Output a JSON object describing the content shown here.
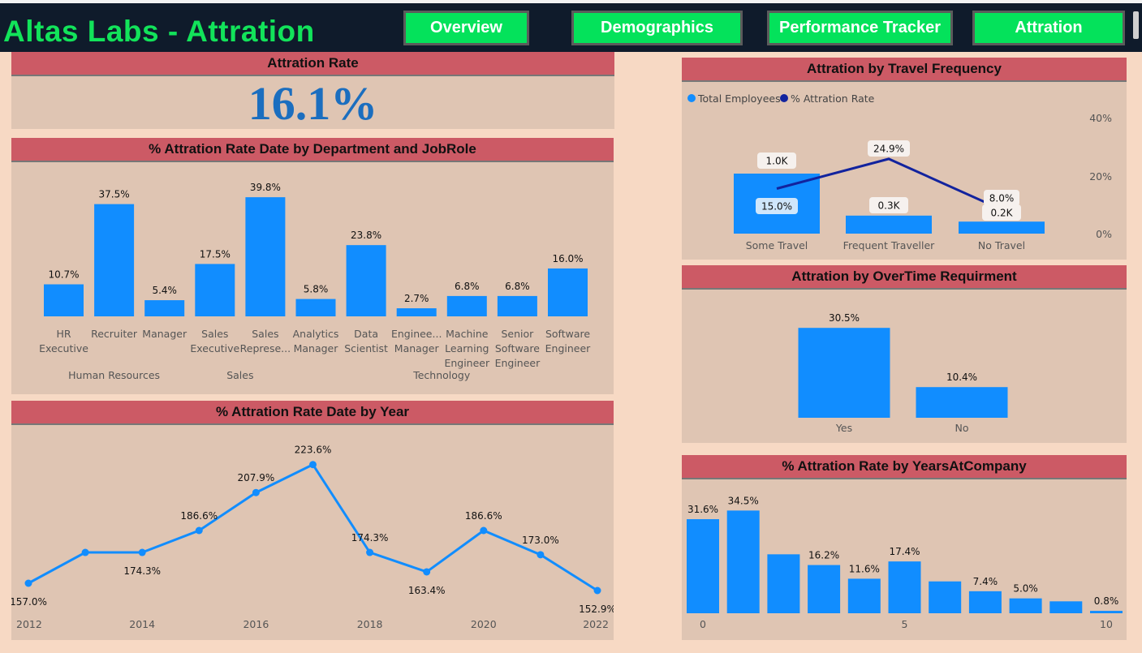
{
  "header": {
    "title": "Altas Labs - Attration",
    "nav": [
      "Overview",
      "Demographics",
      "Performance Tracker",
      "Attration"
    ]
  },
  "colors": {
    "accent": "#118dff",
    "line_dark": "#12239e",
    "header_bar": "#cc5a65",
    "nav_green": "#04e25b",
    "panel_bg": "#dfc5b3",
    "page_bg": "#f7d9c4",
    "kpi_blue": "#1b6ebf"
  },
  "kpi": {
    "title": "Attration Rate",
    "value": "16.1%"
  },
  "panels": {
    "dept_title": "% Attration Rate Date by Department and JobRole",
    "year_title": "% Attration Rate Date by Year",
    "travel_title": "Attration by Travel Frequency",
    "overtime_title": "Attration by OverTime Requirment",
    "years_title": "% Attration Rate by YearsAtCompany"
  },
  "chart_data": [
    {
      "id": "dept",
      "type": "bar",
      "categories": [
        [
          "HR",
          "Executive"
        ],
        [
          "Recruiter"
        ],
        [
          "Manager"
        ],
        [
          "Sales",
          "Executive"
        ],
        [
          "Sales",
          "Represe..."
        ],
        [
          "Analytics",
          "Manager"
        ],
        [
          "Data",
          "Scientist"
        ],
        [
          "Enginee...",
          "Manager"
        ],
        [
          "Machine",
          "Learning",
          "Engineer"
        ],
        [
          "Senior",
          "Software",
          "Engineer"
        ],
        [
          "Software",
          "Engineer"
        ]
      ],
      "groups": [
        {
          "name": "Human Resources",
          "from": 0,
          "to": 2
        },
        {
          "name": "Sales",
          "from": 3,
          "to": 4
        },
        {
          "name": "Technology",
          "from": 5,
          "to": 10
        }
      ],
      "values": [
        10.7,
        37.5,
        5.4,
        17.5,
        39.8,
        5.8,
        23.8,
        2.7,
        6.8,
        6.8,
        16.0
      ],
      "labels": [
        "10.7%",
        "37.5%",
        "5.4%",
        "17.5%",
        "39.8%",
        "5.8%",
        "23.8%",
        "2.7%",
        "6.8%",
        "6.8%",
        "16.0%"
      ],
      "ylim": [
        0,
        42
      ]
    },
    {
      "id": "year",
      "type": "line",
      "x": [
        2012,
        2013,
        2014,
        2015,
        2016,
        2017,
        2018,
        2019,
        2020,
        2021,
        2022
      ],
      "values": [
        157.0,
        174.3,
        174.3,
        186.6,
        207.9,
        223.6,
        174.3,
        163.4,
        186.6,
        173.0,
        152.9
      ],
      "labels": [
        "157.0%",
        "",
        "174.3%",
        "186.6%",
        "207.9%",
        "223.6%",
        "174.3%",
        "163.4%",
        "186.6%",
        "173.0%",
        "152.9%"
      ],
      "xticks": [
        2012,
        2014,
        2016,
        2018,
        2020,
        2022
      ],
      "ylim": [
        140,
        230
      ]
    },
    {
      "id": "travel",
      "type": "bar+line",
      "categories": [
        "Some Travel",
        "Frequent Traveller",
        "No Travel"
      ],
      "series": [
        {
          "name": "Total Employees",
          "values": [
            1.0,
            0.3,
            0.2
          ],
          "labels": [
            "1.0K",
            "0.3K",
            "0.2K"
          ]
        },
        {
          "name": "% Attration Rate",
          "values": [
            15.0,
            24.9,
            8.0
          ],
          "labels": [
            "15.0%",
            "24.9%",
            "8.0%"
          ]
        }
      ],
      "bar_ylim": [
        0,
        1.4
      ],
      "line_ylim": [
        0,
        40
      ],
      "right_axis_ticks": [
        "0%",
        "20%",
        "40%"
      ],
      "legend": "top-left"
    },
    {
      "id": "overtime",
      "type": "bar",
      "categories": [
        "Yes",
        "No"
      ],
      "values": [
        30.5,
        10.4
      ],
      "labels": [
        "30.5%",
        "10.4%"
      ],
      "ylim": [
        0,
        32
      ]
    },
    {
      "id": "years",
      "type": "bar",
      "x": [
        0,
        1,
        2,
        3,
        4,
        5,
        6,
        7,
        8,
        9,
        10
      ],
      "values": [
        31.6,
        34.5,
        19.8,
        16.2,
        11.6,
        17.4,
        10.7,
        7.4,
        5.0,
        4.0,
        0.8
      ],
      "labels": [
        "31.6%",
        "34.5%",
        "",
        "16.2%",
        "11.6%",
        "17.4%",
        "",
        "7.4%",
        "5.0%",
        "",
        "0.8%"
      ],
      "xticks": [
        0,
        5,
        10
      ],
      "ylim": [
        0,
        36
      ]
    }
  ]
}
